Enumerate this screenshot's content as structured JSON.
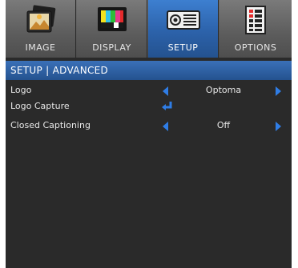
{
  "tabs": [
    {
      "label": "IMAGE",
      "icon": "image-icon",
      "active": false
    },
    {
      "label": "DISPLAY",
      "icon": "display-icon",
      "active": false
    },
    {
      "label": "SETUP",
      "icon": "setup-icon",
      "active": true
    },
    {
      "label": "OPTIONS",
      "icon": "options-icon",
      "active": false
    }
  ],
  "section": {
    "title": "SETUP | ADVANCED"
  },
  "rows": [
    {
      "label": "Logo",
      "value": "Optoma",
      "control": "left-right-arrows"
    },
    {
      "label": "Logo Capture",
      "value": "",
      "control": "enter-icon"
    },
    {
      "label": "Closed Captioning",
      "value": "Off",
      "control": "left-right-arrows"
    }
  ],
  "colors": {
    "active_tab": "#2c62aa",
    "header": "#24528f",
    "arrow": "#2f7de6",
    "background": "#2a2a2a"
  }
}
